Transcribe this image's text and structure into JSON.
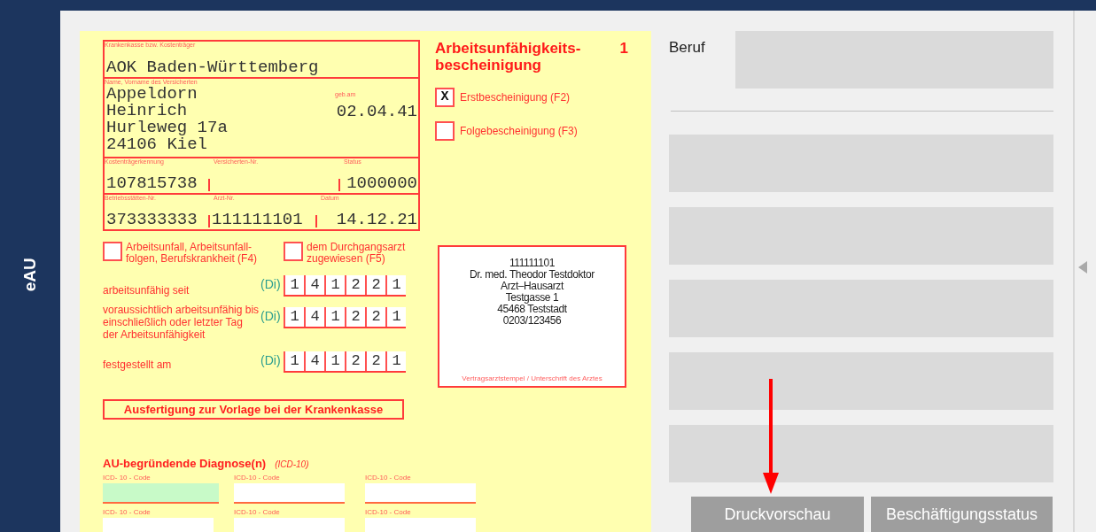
{
  "side_tab": {
    "label": "eAU"
  },
  "form": {
    "insurer": {
      "label": "Krankenkasse bzw. Kostenträger",
      "value": "AOK Baden-Württemberg"
    },
    "patient": {
      "label": "Name, Vorname des Versicherten",
      "lines": [
        "Appeldorn",
        "Heinrich",
        "Hurleweg 17a",
        "24106 Kiel"
      ],
      "dob_label": "geb.am",
      "dob": "02.04.41"
    },
    "id_rows": [
      [
        {
          "label": "Kostenträgerkennung",
          "value": "107815738"
        },
        {
          "label": "Versicherten-Nr."
        },
        {
          "label": "Status",
          "value": "1000000"
        }
      ],
      [
        {
          "label": "Betriebsstätten-Nr.",
          "value": "373333333"
        },
        {
          "label": "Arzt-Nr.",
          "value": "111111101"
        },
        {
          "label": "Datum",
          "value": "14.12.21"
        }
      ]
    ],
    "title_lines": [
      "Arbeitsunfähigkeits-",
      "bescheinigung"
    ],
    "copy_number": "1",
    "check_glyph": "X",
    "certificate_types": [
      {
        "label": "Erstbescheinigung (F2)",
        "checked": true
      },
      {
        "label": "Folgebescheinigung (F3)",
        "checked": false
      }
    ],
    "flags": [
      {
        "lines": [
          "Arbeitsunfall, Arbeitsunfall-",
          "folgen, Berufskrankheit (F4)"
        ],
        "checked": false
      },
      {
        "lines": [
          "dem Durchgangsarzt",
          "zugewiesen (F5)"
        ],
        "checked": false
      }
    ],
    "dates": [
      {
        "label": "arbeitsunfähig seit",
        "weekday": "(Di)",
        "digits": [
          "1",
          "4",
          "1",
          "2",
          "2",
          "1"
        ]
      },
      {
        "label": "voraussichtlich arbeitsunfähig bis einschließlich oder letzter Tag der Arbeitsunfähigkeit",
        "weekday": "(Di)",
        "digits": [
          "1",
          "4",
          "1",
          "2",
          "2",
          "1"
        ]
      },
      {
        "label": "festgestellt am",
        "weekday": "(Di)",
        "digits": [
          "1",
          "4",
          "1",
          "2",
          "2",
          "1"
        ]
      }
    ],
    "copy_banner": "Ausfertigung zur Vorlage bei der Krankenkasse",
    "stamp": {
      "lines": [
        "111111101",
        "Dr. med. Theodor Testdoktor",
        "Arzt–Hausarzt",
        "Testgasse 1",
        "45468 Teststadt",
        "0203/123456"
      ],
      "caption": "Vertragsarztstempel / Unterschrift des Arztes"
    },
    "diagnosis": {
      "title": "AU-begründende Diagnose(n)",
      "subtitle": "(ICD-10)",
      "codes": [
        {
          "label": "ICD- 10 - Code",
          "focused": true
        },
        {
          "label": "ICD-10 - Code",
          "focused": false
        },
        {
          "label": "ICD-10 - Code",
          "focused": false
        },
        {
          "label": "ICD- 10 - Code",
          "focused": false
        },
        {
          "label": "ICD-10 - Code",
          "focused": false
        },
        {
          "label": "ICD-10 - Code",
          "focused": false
        }
      ]
    }
  },
  "right_panel": {
    "occupation_label": "Beruf",
    "buttons": [
      "Druckvorschau",
      "Beschäftigungsstatus"
    ]
  }
}
